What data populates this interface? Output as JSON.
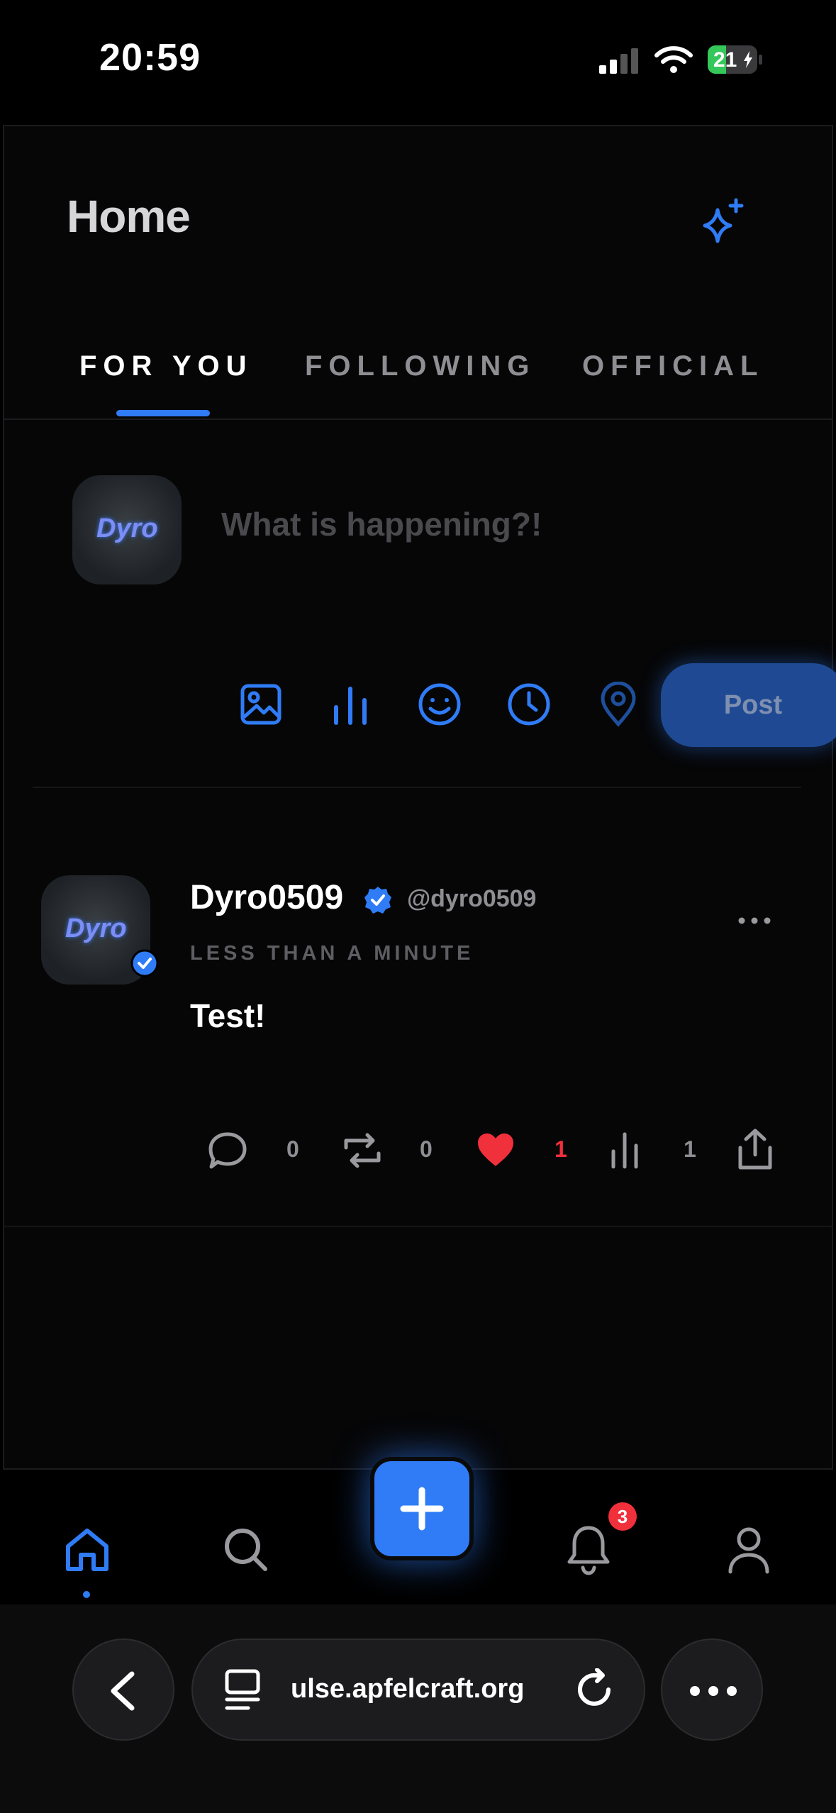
{
  "status_bar": {
    "time": "20:59",
    "battery": "21"
  },
  "header": {
    "title": "Home"
  },
  "tabs": [
    {
      "label": "FOR YOU",
      "active": true
    },
    {
      "label": "FOLLOWING",
      "active": false
    },
    {
      "label": "OFFICIAL",
      "active": false
    }
  ],
  "composer": {
    "placeholder": "What is happening?!",
    "post_label": "Post",
    "avatar_text": "Dyro"
  },
  "post": {
    "author": "Dyro0509",
    "handle": "@dyro0509",
    "time": "LESS THAN A MINUTE",
    "text": "Test!",
    "avatar_text": "Dyro",
    "stats": {
      "replies": "0",
      "reposts": "0",
      "likes": "1",
      "views": "1"
    }
  },
  "nav": {
    "notifications_badge": "3"
  },
  "browser": {
    "url": "ulse.apfelcraft.org"
  },
  "colors": {
    "accent": "#2f7cf6",
    "like": "#f0303b",
    "background": "#000000"
  }
}
